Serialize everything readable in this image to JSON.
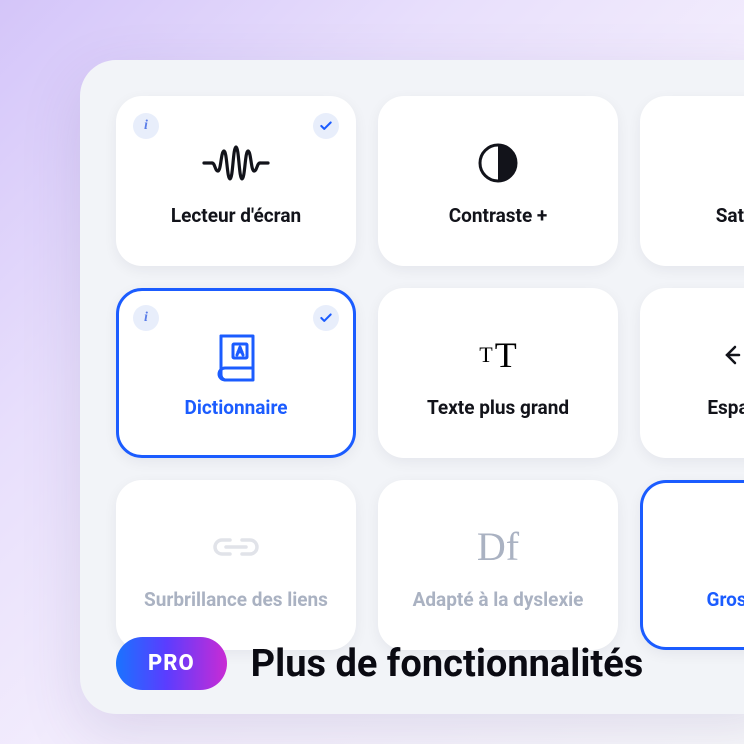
{
  "tiles": [
    {
      "label": "Lecteur d'écran",
      "info": true,
      "check": true
    },
    {
      "label": "Contraste +"
    },
    {
      "label": "Saturation"
    },
    {
      "label": "Dictionnaire",
      "info": true,
      "check": true,
      "selected": true
    },
    {
      "label": "Texte plus grand"
    },
    {
      "label": "Espacement"
    },
    {
      "label": "Surbrillance des liens",
      "faded": true
    },
    {
      "label": "Adapté à la dyslexie",
      "faded": true
    },
    {
      "label": "Gros curseur",
      "cursor_selected": true
    }
  ],
  "footer": {
    "badge": "PRO",
    "text": "Plus de fonctionnalités"
  },
  "info_glyph": "i"
}
